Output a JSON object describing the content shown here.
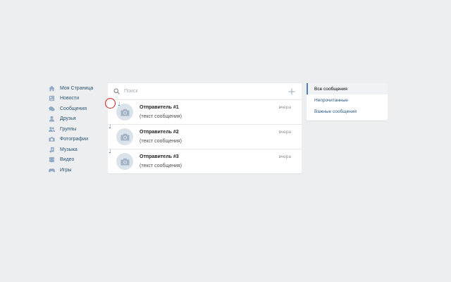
{
  "nav": {
    "items": [
      {
        "label": "Моя Страница",
        "icon": "home-icon"
      },
      {
        "label": "Новости",
        "icon": "news-icon"
      },
      {
        "label": "Сообщения",
        "icon": "messages-icon"
      },
      {
        "label": "Друзья",
        "icon": "friends-icon"
      },
      {
        "label": "Группы",
        "icon": "groups-icon"
      },
      {
        "label": "Фотографии",
        "icon": "camera-icon"
      },
      {
        "label": "Музыка",
        "icon": "music-icon"
      },
      {
        "label": "Видео",
        "icon": "video-icon"
      },
      {
        "label": "Игры",
        "icon": "games-icon"
      }
    ]
  },
  "search": {
    "placeholder": "Поиск"
  },
  "dialogs": [
    {
      "sender": "Отправитель #1",
      "preview": "(текст сообщения)",
      "date": "вчера"
    },
    {
      "sender": "Отправитель #2",
      "preview": "(текст сообщения)",
      "date": "вчера"
    },
    {
      "sender": "Отправитель #3",
      "preview": "(текст сообщения)",
      "date": "вчера"
    }
  ],
  "filters": {
    "items": [
      {
        "label": "Все сообщения",
        "active": true
      },
      {
        "label": "Непрочитанные",
        "active": false
      },
      {
        "label": "Важные сообщения",
        "active": false
      }
    ]
  },
  "colors": {
    "background": "#edeef0",
    "icon": "#8fa8c4",
    "nav_text": "#285473",
    "accent": "#5181b8",
    "note": "#2a6db6",
    "highlight": "#d42222"
  },
  "music_note_glyph": "♩"
}
